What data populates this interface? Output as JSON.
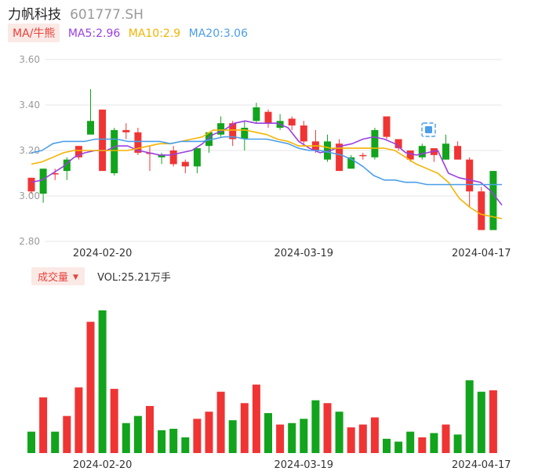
{
  "header": {
    "name": "力帆科技",
    "code": "601777.SH"
  },
  "ma_panel": {
    "tab": "MA/牛熊",
    "items": [
      {
        "label": "MA5:2.96",
        "color": "#9b3fe0"
      },
      {
        "label": "MA10:2.9",
        "color": "#f5b400"
      },
      {
        "label": "MA20:3.06",
        "color": "#4a9eea"
      }
    ]
  },
  "volume_panel": {
    "tab": "成交量",
    "dropdown_icon": "triangle-down-icon",
    "text": "VOL:25.21万手"
  },
  "colors": {
    "up": "#f03434",
    "down": "#12a41c",
    "grid": "#e6e6e6",
    "axis_text": "#9a9a9a"
  },
  "chart_data": [
    {
      "type": "candlestick",
      "ylim": [
        2.8,
        3.6
      ],
      "y_ticks": [
        "3.60",
        "3.40",
        "3.20",
        "3.00",
        "2.80"
      ],
      "x_ticks": [
        {
          "index": 6,
          "label": "2024-02-20"
        },
        {
          "index": 23,
          "label": "2024-03-19"
        },
        {
          "index": 38,
          "label": "2024-04-17"
        }
      ],
      "candles": [
        {
          "o": 3.02,
          "h": 3.08,
          "l": 3.01,
          "c": 3.08
        },
        {
          "o": 3.12,
          "h": 3.12,
          "l": 2.97,
          "c": 3.01
        },
        {
          "o": 3.1,
          "h": 3.12,
          "l": 3.07,
          "c": 3.1
        },
        {
          "o": 3.16,
          "h": 3.17,
          "l": 3.07,
          "c": 3.11
        },
        {
          "o": 3.17,
          "h": 3.22,
          "l": 3.16,
          "c": 3.22
        },
        {
          "o": 3.33,
          "h": 3.47,
          "l": 3.28,
          "c": 3.27
        },
        {
          "o": 3.11,
          "h": 3.38,
          "l": 3.11,
          "c": 3.38
        },
        {
          "o": 3.29,
          "h": 3.3,
          "l": 3.09,
          "c": 3.1
        },
        {
          "o": 3.28,
          "h": 3.32,
          "l": 3.25,
          "c": 3.29
        },
        {
          "o": 3.19,
          "h": 3.3,
          "l": 3.18,
          "c": 3.28
        },
        {
          "o": 3.19,
          "h": 3.22,
          "l": 3.11,
          "c": 3.19
        },
        {
          "o": 3.18,
          "h": 3.19,
          "l": 3.14,
          "c": 3.17
        },
        {
          "o": 3.14,
          "h": 3.22,
          "l": 3.13,
          "c": 3.2
        },
        {
          "o": 3.13,
          "h": 3.16,
          "l": 3.1,
          "c": 3.15
        },
        {
          "o": 3.21,
          "h": 3.21,
          "l": 3.1,
          "c": 3.13
        },
        {
          "o": 3.28,
          "h": 3.28,
          "l": 3.19,
          "c": 3.22
        },
        {
          "o": 3.32,
          "h": 3.35,
          "l": 3.26,
          "c": 3.27
        },
        {
          "o": 3.25,
          "h": 3.33,
          "l": 3.22,
          "c": 3.32
        },
        {
          "o": 3.3,
          "h": 3.33,
          "l": 3.2,
          "c": 3.25
        },
        {
          "o": 3.39,
          "h": 3.41,
          "l": 3.32,
          "c": 3.33
        },
        {
          "o": 3.32,
          "h": 3.38,
          "l": 3.3,
          "c": 3.37
        },
        {
          "o": 3.33,
          "h": 3.36,
          "l": 3.29,
          "c": 3.3
        },
        {
          "o": 3.31,
          "h": 3.35,
          "l": 3.29,
          "c": 3.34
        },
        {
          "o": 3.24,
          "h": 3.33,
          "l": 3.23,
          "c": 3.31
        },
        {
          "o": 3.2,
          "h": 3.29,
          "l": 3.19,
          "c": 3.24
        },
        {
          "o": 3.24,
          "h": 3.27,
          "l": 3.15,
          "c": 3.16
        },
        {
          "o": 3.11,
          "h": 3.25,
          "l": 3.11,
          "c": 3.23
        },
        {
          "o": 3.17,
          "h": 3.18,
          "l": 3.12,
          "c": 3.12
        },
        {
          "o": 3.18,
          "h": 3.19,
          "l": 3.16,
          "c": 3.18
        },
        {
          "o": 3.29,
          "h": 3.3,
          "l": 3.16,
          "c": 3.17
        },
        {
          "o": 3.26,
          "h": 3.35,
          "l": 3.25,
          "c": 3.35
        },
        {
          "o": 3.21,
          "h": 3.25,
          "l": 3.2,
          "c": 3.25
        },
        {
          "o": 3.16,
          "h": 3.2,
          "l": 3.15,
          "c": 3.2
        },
        {
          "o": 3.22,
          "h": 3.23,
          "l": 3.16,
          "c": 3.17
        },
        {
          "o": 3.18,
          "h": 3.21,
          "l": 3.15,
          "c": 3.21
        },
        {
          "o": 3.23,
          "h": 3.27,
          "l": 3.16,
          "c": 3.16
        },
        {
          "o": 3.16,
          "h": 3.24,
          "l": 3.16,
          "c": 3.22
        },
        {
          "o": 3.02,
          "h": 3.17,
          "l": 2.95,
          "c": 3.16
        },
        {
          "o": 2.85,
          "h": 3.04,
          "l": 2.85,
          "c": 3.02
        },
        {
          "o": 3.11,
          "h": 3.11,
          "l": 2.85,
          "c": 2.85
        }
      ],
      "ma_lines": [
        {
          "name": "MA5",
          "color": "#9b3fe0",
          "values": [
            3.06,
            3.07,
            3.1,
            3.13,
            3.17,
            3.19,
            3.2,
            3.2,
            3.22,
            3.22,
            3.2,
            3.19,
            3.18,
            3.18,
            3.19,
            3.2,
            3.23,
            3.27,
            3.29,
            3.32,
            3.33,
            3.32,
            3.32,
            3.32,
            3.3,
            3.24,
            3.21,
            3.19,
            3.2,
            3.22,
            3.23,
            3.25,
            3.26,
            3.25,
            3.23,
            3.19,
            3.18,
            3.19,
            3.2,
            3.1,
            3.08,
            3.07,
            3.06,
            3.02,
            2.96
          ]
        },
        {
          "name": "MA10",
          "color": "#f5b400",
          "values": [
            3.14,
            3.15,
            3.17,
            3.19,
            3.2,
            3.2,
            3.2,
            3.2,
            3.2,
            3.2,
            3.21,
            3.22,
            3.23,
            3.23,
            3.24,
            3.25,
            3.26,
            3.29,
            3.29,
            3.29,
            3.29,
            3.28,
            3.27,
            3.25,
            3.24,
            3.22,
            3.22,
            3.22,
            3.21,
            3.21,
            3.21,
            3.21,
            3.21,
            3.21,
            3.2,
            3.17,
            3.14,
            3.12,
            3.1,
            3.06,
            2.99,
            2.95,
            2.92,
            2.91,
            2.9
          ]
        },
        {
          "name": "MA20",
          "color": "#4a9eea",
          "values": [
            3.19,
            3.2,
            3.23,
            3.24,
            3.24,
            3.24,
            3.25,
            3.25,
            3.25,
            3.24,
            3.24,
            3.24,
            3.24,
            3.23,
            3.24,
            3.24,
            3.24,
            3.25,
            3.26,
            3.26,
            3.25,
            3.25,
            3.25,
            3.24,
            3.23,
            3.21,
            3.2,
            3.2,
            3.19,
            3.18,
            3.16,
            3.13,
            3.09,
            3.07,
            3.07,
            3.06,
            3.06,
            3.05,
            3.05,
            3.05,
            3.05,
            3.05,
            3.05,
            3.05,
            3.05
          ]
        }
      ]
    },
    {
      "type": "bar",
      "name": "volume",
      "ylim": [
        0,
        100
      ],
      "x_ticks": [
        {
          "index": 6,
          "label": "2024-02-20"
        },
        {
          "index": 23,
          "label": "2024-03-19"
        },
        {
          "index": 38,
          "label": "2024-04-17"
        }
      ],
      "bars": [
        {
          "v": 15,
          "d": "down"
        },
        {
          "v": 39,
          "d": "up"
        },
        {
          "v": 15,
          "d": "down"
        },
        {
          "v": 26,
          "d": "up"
        },
        {
          "v": 46,
          "d": "up"
        },
        {
          "v": 92,
          "d": "up"
        },
        {
          "v": 100,
          "d": "down"
        },
        {
          "v": 45,
          "d": "up"
        },
        {
          "v": 21,
          "d": "down"
        },
        {
          "v": 26,
          "d": "down"
        },
        {
          "v": 33,
          "d": "up"
        },
        {
          "v": 16,
          "d": "down"
        },
        {
          "v": 17,
          "d": "down"
        },
        {
          "v": 11,
          "d": "down"
        },
        {
          "v": 24,
          "d": "up"
        },
        {
          "v": 29,
          "d": "up"
        },
        {
          "v": 43,
          "d": "up"
        },
        {
          "v": 23,
          "d": "down"
        },
        {
          "v": 35,
          "d": "up"
        },
        {
          "v": 48,
          "d": "up"
        },
        {
          "v": 28,
          "d": "down"
        },
        {
          "v": 20,
          "d": "up"
        },
        {
          "v": 21,
          "d": "down"
        },
        {
          "v": 24,
          "d": "down"
        },
        {
          "v": 37,
          "d": "down"
        },
        {
          "v": 35,
          "d": "up"
        },
        {
          "v": 29,
          "d": "down"
        },
        {
          "v": 18,
          "d": "up"
        },
        {
          "v": 20,
          "d": "up"
        },
        {
          "v": 25,
          "d": "up"
        },
        {
          "v": 10,
          "d": "down"
        },
        {
          "v": 8,
          "d": "down"
        },
        {
          "v": 15,
          "d": "down"
        },
        {
          "v": 11,
          "d": "up"
        },
        {
          "v": 14,
          "d": "down"
        },
        {
          "v": 20,
          "d": "up"
        },
        {
          "v": 13,
          "d": "down"
        },
        {
          "v": 51,
          "d": "down"
        },
        {
          "v": 43,
          "d": "down"
        },
        {
          "v": 44,
          "d": "up"
        }
      ]
    }
  ]
}
